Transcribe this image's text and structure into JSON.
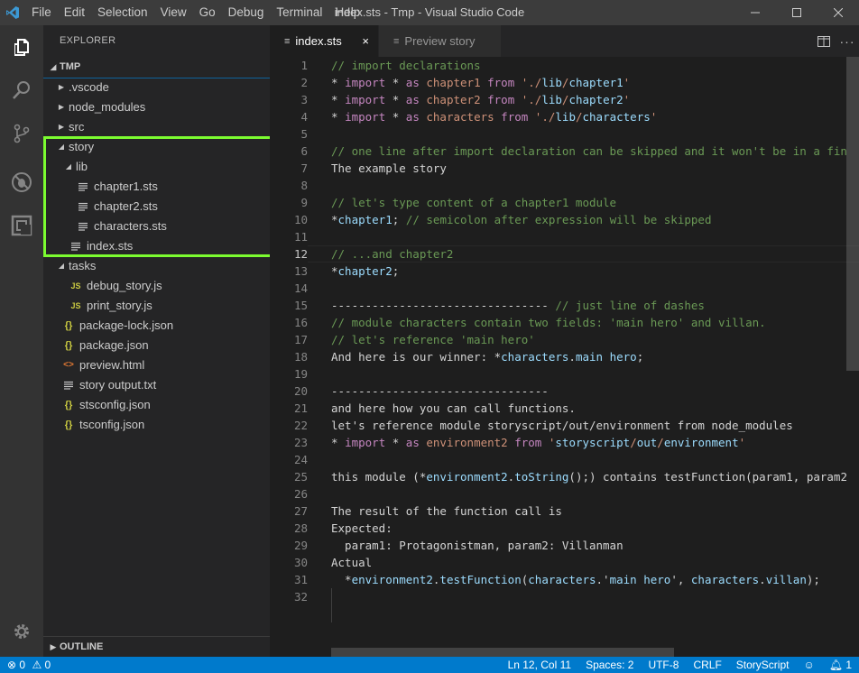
{
  "window": {
    "title": "index.sts - Tmp - Visual Studio Code",
    "menu": [
      "File",
      "Edit",
      "Selection",
      "View",
      "Go",
      "Debug",
      "Terminal",
      "Help"
    ]
  },
  "activity_bar": {
    "items": [
      "explorer-icon",
      "search-icon",
      "source-control-icon",
      "debug-icon",
      "extensions-icon"
    ],
    "bottom": "settings-gear-icon"
  },
  "sidebar": {
    "header": "EXPLORER",
    "section": "TMP",
    "tree": [
      {
        "label": ".vscode",
        "type": "folder",
        "state": "collapsed",
        "depth": 0
      },
      {
        "label": "node_modules",
        "type": "folder",
        "state": "collapsed",
        "depth": 0
      },
      {
        "label": "src",
        "type": "folder",
        "state": "collapsed",
        "depth": 0
      },
      {
        "label": "story",
        "type": "folder",
        "state": "expanded",
        "depth": 0
      },
      {
        "label": "lib",
        "type": "folder",
        "state": "expanded",
        "depth": 1
      },
      {
        "label": "chapter1.sts",
        "type": "sts",
        "depth": 2
      },
      {
        "label": "chapter2.sts",
        "type": "sts",
        "depth": 2
      },
      {
        "label": "characters.sts",
        "type": "sts",
        "depth": 2
      },
      {
        "label": "index.sts",
        "type": "sts",
        "depth": 1
      },
      {
        "label": "tasks",
        "type": "folder",
        "state": "expanded",
        "depth": 0
      },
      {
        "label": "debug_story.js",
        "type": "js",
        "icon": "JS",
        "depth": 1
      },
      {
        "label": "print_story.js",
        "type": "js",
        "icon": "JS",
        "depth": 1
      },
      {
        "label": "package-lock.json",
        "type": "json",
        "icon": "{}",
        "depth": 0
      },
      {
        "label": "package.json",
        "type": "json",
        "icon": "{}",
        "depth": 0
      },
      {
        "label": "preview.html",
        "type": "html",
        "icon": "<>",
        "depth": 0
      },
      {
        "label": "story output.txt",
        "type": "txt",
        "depth": 0
      },
      {
        "label": "stsconfig.json",
        "type": "json",
        "icon": "{}",
        "depth": 0
      },
      {
        "label": "tsconfig.json",
        "type": "json",
        "icon": "{}",
        "depth": 0
      }
    ],
    "outline": "OUTLINE"
  },
  "tabs": [
    {
      "label": "index.sts",
      "active": true,
      "close": "×"
    },
    {
      "label": "Preview story",
      "active": false
    }
  ],
  "editor": {
    "current_line": 12,
    "lines": [
      [
        {
          "t": "// import declarations",
          "c": "com"
        }
      ],
      [
        {
          "t": "* ",
          "c": "op"
        },
        {
          "t": "import",
          "c": "kw2"
        },
        {
          "t": " * ",
          "c": "op"
        },
        {
          "t": "as",
          "c": "kw2"
        },
        {
          "t": " chapter1 ",
          "c": "str"
        },
        {
          "t": "from",
          "c": "kw2"
        },
        {
          "t": " './",
          "c": "str"
        },
        {
          "t": "lib",
          "c": "id"
        },
        {
          "t": "/",
          "c": "str"
        },
        {
          "t": "chapter1",
          "c": "id"
        },
        {
          "t": "'",
          "c": "str"
        }
      ],
      [
        {
          "t": "* ",
          "c": "op"
        },
        {
          "t": "import",
          "c": "kw2"
        },
        {
          "t": " * ",
          "c": "op"
        },
        {
          "t": "as",
          "c": "kw2"
        },
        {
          "t": " chapter2 ",
          "c": "str"
        },
        {
          "t": "from",
          "c": "kw2"
        },
        {
          "t": " './",
          "c": "str"
        },
        {
          "t": "lib",
          "c": "id"
        },
        {
          "t": "/",
          "c": "str"
        },
        {
          "t": "chapter2",
          "c": "id"
        },
        {
          "t": "'",
          "c": "str"
        }
      ],
      [
        {
          "t": "* ",
          "c": "op"
        },
        {
          "t": "import",
          "c": "kw2"
        },
        {
          "t": " * ",
          "c": "op"
        },
        {
          "t": "as",
          "c": "kw2"
        },
        {
          "t": " characters ",
          "c": "str"
        },
        {
          "t": "from",
          "c": "kw2"
        },
        {
          "t": " './",
          "c": "str"
        },
        {
          "t": "lib",
          "c": "id"
        },
        {
          "t": "/",
          "c": "str"
        },
        {
          "t": "characters",
          "c": "id"
        },
        {
          "t": "'",
          "c": "str"
        }
      ],
      [],
      [
        {
          "t": "// one line after import declaration can be skipped and it won't be in a fin",
          "c": "com"
        }
      ],
      [
        {
          "t": "The example story",
          "c": "op"
        }
      ],
      [],
      [
        {
          "t": "// let's type content of a chapter1 module",
          "c": "com"
        }
      ],
      [
        {
          "t": "*",
          "c": "op"
        },
        {
          "t": "chapter1",
          "c": "id"
        },
        {
          "t": "; ",
          "c": "op"
        },
        {
          "t": "// semicolon after expression will be skipped",
          "c": "com"
        }
      ],
      [],
      [
        {
          "t": "// ...and chapter2",
          "c": "com"
        }
      ],
      [
        {
          "t": "*",
          "c": "op"
        },
        {
          "t": "chapter2",
          "c": "id"
        },
        {
          "t": ";",
          "c": "op"
        }
      ],
      [],
      [
        {
          "t": "-------------------------------- ",
          "c": "op"
        },
        {
          "t": "// just line of dashes",
          "c": "com"
        }
      ],
      [
        {
          "t": "// module characters contain two fields: 'main hero' and villan.",
          "c": "com"
        }
      ],
      [
        {
          "t": "// let's reference 'main hero'",
          "c": "com"
        }
      ],
      [
        {
          "t": "And here is our winner: *",
          "c": "op"
        },
        {
          "t": "characters",
          "c": "id"
        },
        {
          "t": ".",
          "c": "op"
        },
        {
          "t": "main hero",
          "c": "id"
        },
        {
          "t": ";",
          "c": "op"
        }
      ],
      [],
      [
        {
          "t": "--------------------------------",
          "c": "op"
        }
      ],
      [
        {
          "t": "and here how you can call functions.",
          "c": "op"
        }
      ],
      [
        {
          "t": "let's reference module storyscript/out/environment from node_modules",
          "c": "op"
        }
      ],
      [
        {
          "t": "* ",
          "c": "op"
        },
        {
          "t": "import",
          "c": "kw2"
        },
        {
          "t": " * ",
          "c": "op"
        },
        {
          "t": "as",
          "c": "kw2"
        },
        {
          "t": " environment2 ",
          "c": "str"
        },
        {
          "t": "from",
          "c": "kw2"
        },
        {
          "t": " '",
          "c": "str"
        },
        {
          "t": "storyscript",
          "c": "id"
        },
        {
          "t": "/",
          "c": "str"
        },
        {
          "t": "out",
          "c": "id"
        },
        {
          "t": "/",
          "c": "str"
        },
        {
          "t": "environment",
          "c": "id"
        },
        {
          "t": "'",
          "c": "str"
        }
      ],
      [],
      [
        {
          "t": "this module (*",
          "c": "op"
        },
        {
          "t": "environment2",
          "c": "id"
        },
        {
          "t": ".",
          "c": "op"
        },
        {
          "t": "toString",
          "c": "id"
        },
        {
          "t": "();) contains testFunction(param1, param2",
          "c": "op"
        }
      ],
      [],
      [
        {
          "t": "The result of the function call is",
          "c": "op"
        }
      ],
      [
        {
          "t": "Expected:",
          "c": "op"
        }
      ],
      [
        {
          "t": "  param1: Protagonistman, param2: Villanman",
          "c": "op"
        }
      ],
      [
        {
          "t": "Actual",
          "c": "op"
        }
      ],
      [
        {
          "t": "  *",
          "c": "op"
        },
        {
          "t": "environment2",
          "c": "id"
        },
        {
          "t": ".",
          "c": "op"
        },
        {
          "t": "testFunction",
          "c": "id"
        },
        {
          "t": "(",
          "c": "op"
        },
        {
          "t": "characters",
          "c": "id"
        },
        {
          "t": ".'",
          "c": "op"
        },
        {
          "t": "main hero",
          "c": "id"
        },
        {
          "t": "', ",
          "c": "op"
        },
        {
          "t": "characters",
          "c": "id"
        },
        {
          "t": ".",
          "c": "op"
        },
        {
          "t": "villan",
          "c": "id"
        },
        {
          "t": ");",
          "c": "op"
        }
      ],
      []
    ]
  },
  "statusbar": {
    "errors": "0",
    "warnings": "0",
    "position": "Ln 12, Col 11",
    "spaces": "Spaces: 2",
    "encoding": "UTF-8",
    "eol": "CRLF",
    "language": "StoryScript",
    "notifications": "1"
  },
  "colors": {
    "accent": "#007acc",
    "highlight_box": "#7cfc30"
  }
}
